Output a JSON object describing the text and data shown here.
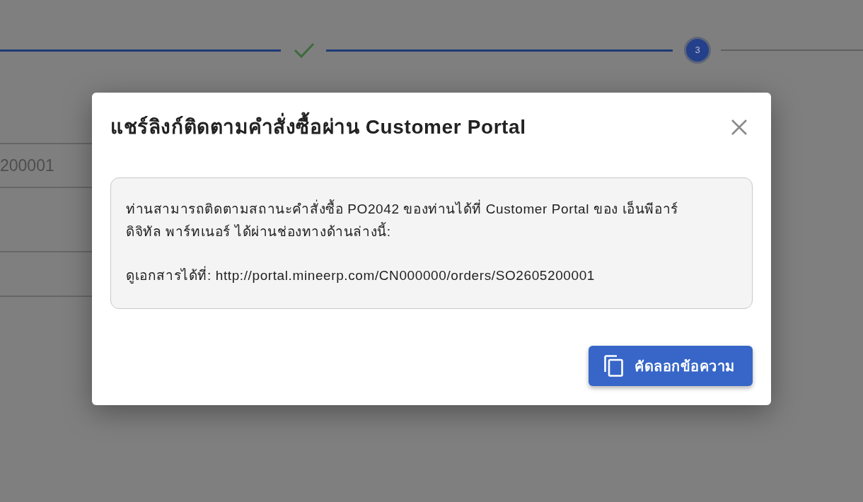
{
  "stepper": {
    "steps": [
      {
        "kind": "done"
      },
      {
        "kind": "current",
        "number": "3"
      }
    ]
  },
  "background_field": {
    "value": "200001"
  },
  "dialog": {
    "title": "แชร์ลิงก์ติดตามคำสั่งซื้อผ่าน Customer Portal",
    "message": [
      "ท่านสามารถติดตามสถานะคำสั่งซื้อ PO2042 ของท่านได้ที่ Customer Portal ของ เอ็นพีอาร์ ดิจิทัล พาร์ทเนอร์ ได้ผ่านช่องทางด้านล่างนี้:",
      "ดูเอกสารได้ที่: http://portal.mineerp.com/CN000000/orders/SO2605200001"
    ],
    "copy_button": {
      "label": "คัดลอกข้อความ"
    }
  }
}
